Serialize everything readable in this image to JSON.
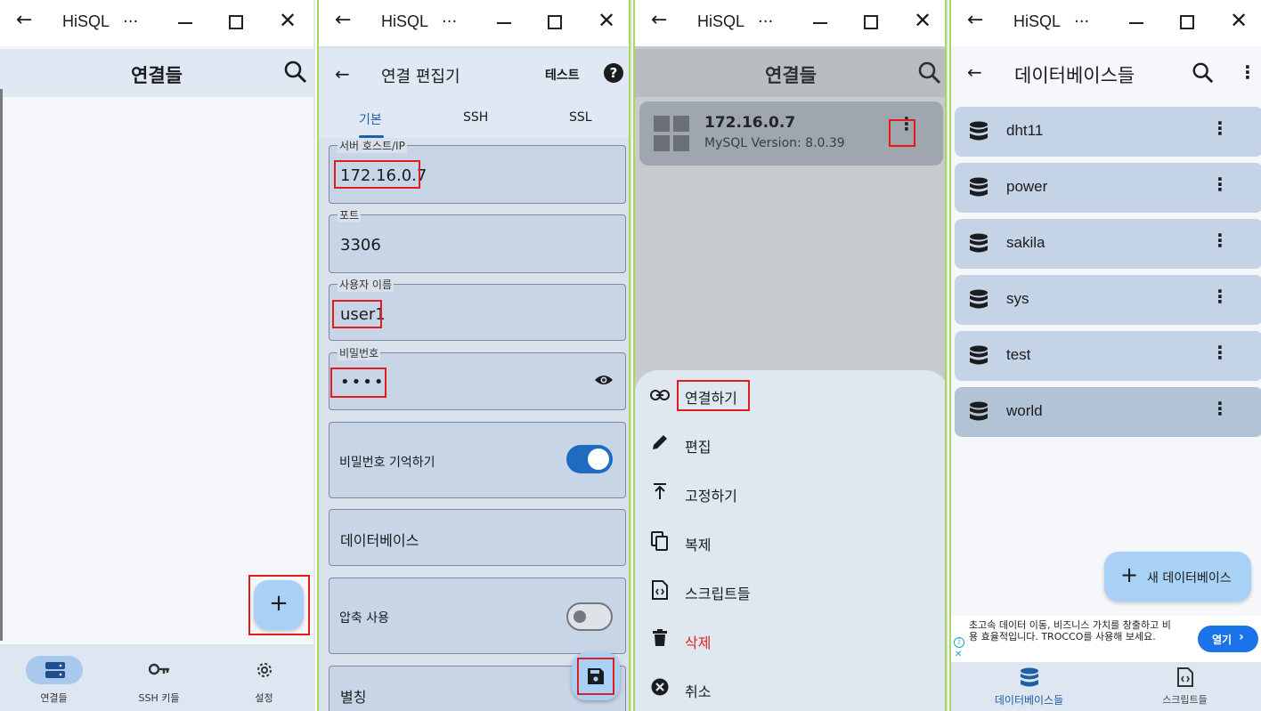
{
  "window": {
    "title": "HiSQL",
    "back_glyph": "←",
    "more_glyph": "···",
    "close_glyph": "✕"
  },
  "panel1": {
    "appbar_title": "연결들",
    "fab_label": "+",
    "nav": [
      {
        "label": "연결들",
        "icon": "server-icon",
        "active": true
      },
      {
        "label": "SSH 키들",
        "icon": "key-icon",
        "active": false
      },
      {
        "label": "설정",
        "icon": "gear-icon",
        "active": false
      }
    ]
  },
  "panel2": {
    "appbar_title": "연결 편집기",
    "test_label": "테스트",
    "help_glyph": "?",
    "tabs": [
      "기본",
      "SSH",
      "SSL"
    ],
    "active_tab": "기본",
    "fields": {
      "host_label": "서버 호스트/IP",
      "host_value": "172.16.0.7",
      "port_label": "포트",
      "port_value": "3306",
      "user_label": "사용자 이름",
      "user_value": "user1",
      "password_label": "비밀번호",
      "password_value": "••••"
    },
    "remember_password_label": "비밀번호 기억하기",
    "remember_password_on": true,
    "database_label": "데이터베이스",
    "compression_label": "압축 사용",
    "compression_on": false,
    "alias_label": "별칭"
  },
  "panel3": {
    "appbar_title": "연결들",
    "connection": {
      "host": "172.16.0.7",
      "version": "MySQL Version: 8.0.39"
    },
    "menu": [
      {
        "label": "연결하기",
        "icon": "link-icon",
        "color": "#1a1c1e"
      },
      {
        "label": "편집",
        "icon": "pencil-icon",
        "color": "#1a1c1e"
      },
      {
        "label": "고정하기",
        "icon": "pin-icon",
        "color": "#1a1c1e"
      },
      {
        "label": "복제",
        "icon": "copy-icon",
        "color": "#1a1c1e"
      },
      {
        "label": "스크립트들",
        "icon": "script-file-icon",
        "color": "#1a1c1e"
      },
      {
        "label": "삭제",
        "icon": "trash-icon",
        "color": "#e0241f"
      },
      {
        "label": "취소",
        "icon": "cancel-icon",
        "color": "#1a1c1e"
      }
    ]
  },
  "panel4": {
    "appbar_title": "데이터베이스들",
    "databases": [
      "dht11",
      "power",
      "sakila",
      "sys",
      "test",
      "world"
    ],
    "fab_label": "새 데이터베이스",
    "ad": {
      "text": "초고속 데이터 이동, 비즈니스 가치를 창출하고 비용 효율적입니다. TROCCO를 사용해 보세요.",
      "button": "열기"
    },
    "nav": [
      {
        "label": "데이터베이스들",
        "icon": "database-icon"
      },
      {
        "label": "스크립트들",
        "icon": "script-file-icon"
      }
    ]
  }
}
